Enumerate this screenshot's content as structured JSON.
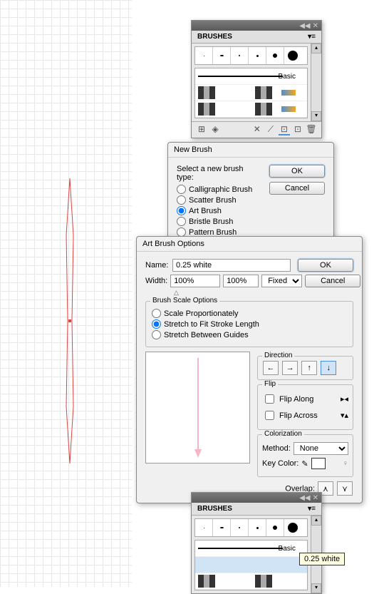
{
  "brushesPanel1": {
    "title": "BRUSHES",
    "menuIcon": "▾≡",
    "basicLabel": "Basic",
    "bottomIcons": [
      "⊞",
      "◈",
      "✕",
      "⟋",
      "⊡",
      "⊡",
      "🗑"
    ]
  },
  "newBrushDialog": {
    "title": "New Brush",
    "prompt": "Select a new brush type:",
    "options": {
      "calligraphic": "Calligraphic Brush",
      "scatter": "Scatter Brush",
      "art": "Art Brush",
      "bristle": "Bristle Brush",
      "pattern": "Pattern Brush"
    },
    "selected": "art",
    "ok": "OK",
    "cancel": "Cancel"
  },
  "artBrushDialog": {
    "title": "Art Brush Options",
    "nameLabel": "Name:",
    "nameValue": "0.25 white",
    "widthLabel": "Width:",
    "widthValue": "100%",
    "widthTo": "100%",
    "widthMode": "Fixed",
    "ok": "OK",
    "cancel": "Cancel",
    "scaleGroup": "Brush Scale Options",
    "scaleOptions": {
      "prop": "Scale Proportionately",
      "stretch": "Stretch to Fit Stroke Length",
      "between": "Stretch Between Guides"
    },
    "scaleSelected": "stretch",
    "directionLabel": "Direction",
    "flipLabel": "Flip",
    "flipAlong": "Flip Along",
    "flipAcross": "Flip Across",
    "colorLabel": "Colorization",
    "methodLabel": "Method:",
    "methodValue": "None",
    "keyColorLabel": "Key Color:",
    "overlapLabel": "Overlap:"
  },
  "brushesPanel2": {
    "title": "BRUSHES",
    "basicLabel": "Basic"
  },
  "tooltip": "0.25 white"
}
